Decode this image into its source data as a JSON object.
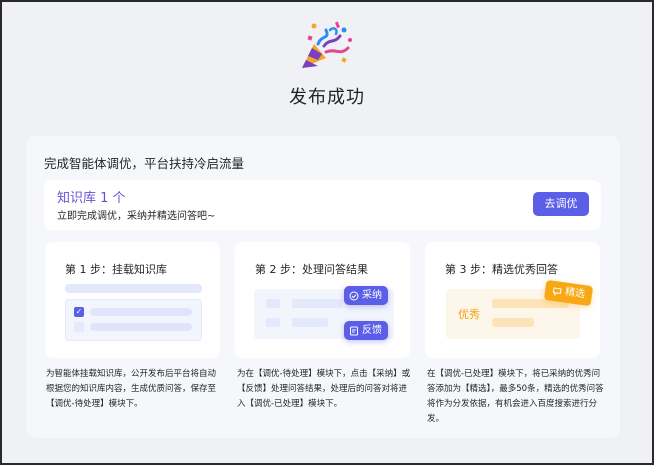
{
  "page": {
    "title": "发布成功",
    "icon": "party-popper-icon"
  },
  "main": {
    "heading": "完成智能体调优，平台扶持冷启流量",
    "knowledge": {
      "title": "知识库 1 个",
      "subtitle": "立即完成调优，采纳并精选问答吧~",
      "button": "去调优"
    },
    "steps": [
      {
        "title": "第 1 步：挂载知识库",
        "desc": "为智能体挂载知识库，公开发布后平台将自动根据您的知识库内容，生成优质问答，保存至【调优-待处理】模块下。"
      },
      {
        "title": "第 2 步：处理问答结果",
        "desc": "为在【调优-待处理】模块下，点击【采纳】或【反馈】处理问答结果，处理后的问答对将进入【调优-已处理】模块下。",
        "chips": [
          "采纳",
          "反馈"
        ]
      },
      {
        "title": "第 3 步：精选优秀回答",
        "desc": "在【调优-已处理】模块下，将已采纳的优秀问答添加为【精选】，最多50条，精选的优秀问答将作为分发依据，有机会进入百度搜索进行分发。",
        "label": "优秀",
        "tag": "精选"
      }
    ]
  },
  "colors": {
    "accent": "#5b5ee6",
    "title_purple": "#6b4fd8",
    "highlight_orange": "#f8a815",
    "background": "#eff1f5"
  }
}
